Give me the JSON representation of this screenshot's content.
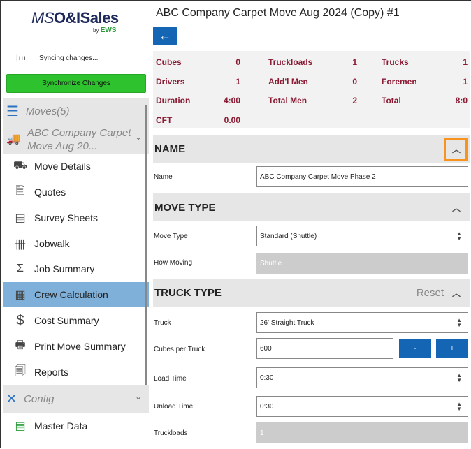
{
  "sidebar": {
    "logo_ms": "MS",
    "logo_oi": "O&ISales",
    "logo_by": "by",
    "logo_ews": "EWS",
    "sync_status": "Syncing changes...",
    "sync_button": "Synchronize Changes",
    "moves_group": "Moves(5)",
    "current_move": "ABC Company Carpet Move Aug 20...",
    "items": [
      {
        "label": "Move Details",
        "icon": "truck-outline-icon"
      },
      {
        "label": "Quotes",
        "icon": "document-icon"
      },
      {
        "label": "Survey Sheets",
        "icon": "list-icon"
      },
      {
        "label": "Jobwalk",
        "icon": "tally-icon"
      },
      {
        "label": "Job Summary",
        "icon": "sigma-icon"
      },
      {
        "label": "Crew Calculation",
        "icon": "calculator-icon"
      },
      {
        "label": "Cost Summary",
        "icon": "dollar-icon"
      },
      {
        "label": "Print Move Summary",
        "icon": "printer-icon"
      },
      {
        "label": "Reports",
        "icon": "report-icon"
      }
    ],
    "config_group": "Config",
    "master_data": "Master Data"
  },
  "header": {
    "title": "ABC Company Carpet Move Aug 2024 (Copy) #1",
    "back": "←"
  },
  "stats": [
    {
      "label": "Cubes",
      "value": "0"
    },
    {
      "label": "Truckloads",
      "value": "1"
    },
    {
      "label": "Trucks",
      "value": "1"
    },
    {
      "label": "Drivers",
      "value": "1"
    },
    {
      "label": "Add'l Men",
      "value": "0"
    },
    {
      "label": "Foremen",
      "value": "1"
    },
    {
      "label": "Duration",
      "value": "4:00"
    },
    {
      "label": "Total Men",
      "value": "2"
    },
    {
      "label": "Total",
      "value": "8:0"
    },
    {
      "label": "CFT",
      "value": "0.00"
    }
  ],
  "name_section": {
    "title": "NAME",
    "name_label": "Name",
    "name_value": "ABC Company Carpet Move Phase 2"
  },
  "move_type_section": {
    "title": "MOVE TYPE",
    "move_type_label": "Move Type",
    "move_type_value": "Standard (Shuttle)",
    "how_moving_label": "How Moving",
    "how_moving_value": "Shuttle"
  },
  "truck_section": {
    "title": "TRUCK TYPE",
    "reset": "Reset",
    "truck_label": "Truck",
    "truck_value": "26' Straight Truck",
    "cubes_label": "Cubes per Truck",
    "cubes_value": "600",
    "minus": "-",
    "plus": "+",
    "load_label": "Load Time",
    "load_value": "0:30",
    "unload_label": "Unload Time",
    "unload_value": "0:30",
    "truckloads_label": "Truckloads",
    "truckloads_value": "1"
  }
}
